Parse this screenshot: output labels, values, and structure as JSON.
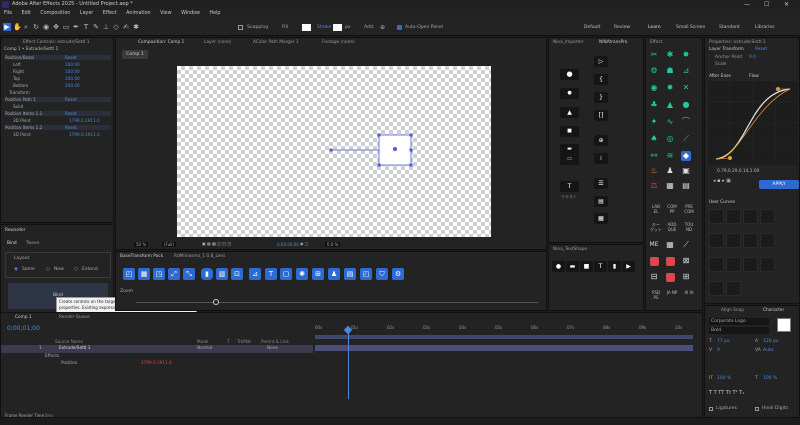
{
  "app": {
    "title": "Adobe After Effects 2025 - Untitled Project.aep *",
    "window_controls": [
      "—",
      "☐",
      "✕"
    ]
  },
  "menu": [
    "File",
    "Edit",
    "Composition",
    "Layer",
    "Effect",
    "Animation",
    "View",
    "Window",
    "Help"
  ],
  "toolbar": {
    "snapping_label": "Snapping",
    "fill_label": "Fill",
    "stroke_label": "Stroke",
    "stroke_value": "px",
    "add_label": "Add:",
    "auto_open_label": "Auto-Open Panel",
    "workspaces": [
      "Default",
      "Review",
      "Learn",
      "Small Screen",
      "Standard",
      "Libraries"
    ],
    "active_workspace": "Learn"
  },
  "effect_controls": {
    "tab": "Effect Controls: extrude/Settl 1",
    "title": "Comp 1 • Extrude/Settl 1",
    "rows": [
      {
        "label": "Position/Bezel",
        "value": "Reset",
        "indent": 0
      },
      {
        "label": "Left",
        "value": "100.00",
        "indent": 1
      },
      {
        "label": "Right",
        "value": "100.00",
        "indent": 1
      },
      {
        "label": "Top",
        "value": "100.00",
        "indent": 1
      },
      {
        "label": "Bottom",
        "value": "100.00",
        "indent": 1
      },
      {
        "label": "Transform",
        "value": "",
        "indent": 0
      },
      {
        "label": "Position Path 1",
        "value": "Reset",
        "indent": 0
      },
      {
        "label": "Solid",
        "value": "",
        "indent": 1
      },
      {
        "label": "Position Items 1.1",
        "value": "Reset",
        "indent": 0
      },
      {
        "label": "3D Point",
        "value": "1799.0,1911.0",
        "indent": 1
      },
      {
        "label": "Position Items 1.2",
        "value": "Reset",
        "indent": 0
      },
      {
        "label": "3D Point",
        "value": "1799.0,1911.0",
        "indent": 1
      }
    ]
  },
  "rewarder": {
    "tab": "Rewarder",
    "tabs": [
      "Bind",
      "Tween"
    ],
    "group": "Layout",
    "radios": [
      "Same",
      "New",
      "Extend"
    ],
    "button": "Bind",
    "tooltip": "Create controls on the target layer and bind them to the selected properties. Existing expressions will be replaced."
  },
  "composition": {
    "panel_tab": "Composition: Comp 1",
    "tabs": [
      "Layer (none)",
      "AColor Path Merger 1",
      "Footage (none)"
    ],
    "comp_label": "Comp 1",
    "zoom": "50 %",
    "resolution": "(Full)",
    "timecode": "0;00;00;00",
    "camera": "0.0 %"
  },
  "quick_panel": {
    "tabs": [
      "BaseTransform Pack",
      "RdMiniasmo_1.0.8_Lens"
    ],
    "zoom_label": "Zoom"
  },
  "nina_importer": {
    "tab": "Nina_Importer",
    "second_tab": "NINAtransPro",
    "thumb_label": "テキスト"
  },
  "nina_textshape": {
    "tab": "Nina_TextShape"
  },
  "effects_tab": "Effect",
  "text_buttons": [
    "LAB EL",
    "COM PP",
    "PRE COM",
    "キー ゲット",
    "ADD QUE",
    "TOU ND",
    "PSD PS",
    "JA NP",
    "AI AI"
  ],
  "flow_panel": {
    "tabs": [
      "Properties: extrude/Settl 1",
      "Effect Color"
    ],
    "subtabs": [
      "After Ease",
      "Flow"
    ],
    "sub_label": "Layer Transform",
    "sub_value": "Reset",
    "rows": [
      {
        "label": "Anchor Point",
        "value": "0.0"
      },
      {
        "label": "Scale",
        "value": ""
      }
    ],
    "values": "0.79,0.29,0.14,1.00",
    "apply_label": "APPLY",
    "curves_label": "User Curves"
  },
  "character": {
    "tabs": [
      "Align Snap",
      "Character"
    ],
    "font": "Corporate Logo",
    "style": "Bold",
    "size": "77 px",
    "leading": "120 px",
    "tracking": "Auto",
    "kerning": "0",
    "scale_v": "100 %",
    "scale_h": "100 %",
    "ligatures": "Ligatures",
    "hindi": "Hindi Digits"
  },
  "timeline": {
    "tab": "Comp 1",
    "render_tab": "Render Queue",
    "timecode": "0;00;01;00",
    "columns": [
      "Source Name",
      "Mode",
      "T",
      "TrkMat",
      "Parent & Link"
    ],
    "layers": [
      {
        "num": "1",
        "name": "Extrude/Settl 1",
        "mode": "Normal",
        "parent": "None"
      },
      {
        "name": "Effects"
      },
      {
        "name": "Position",
        "value": "1799.0,1911.0"
      }
    ],
    "ruler": [
      "00s",
      "01s",
      "02s",
      "03s",
      "04s",
      "05s",
      "06s",
      "07s",
      "08s",
      "09s",
      "10s"
    ],
    "footer": "Frame Render Time",
    "footer_val": "0ms"
  },
  "colors": {
    "accent": "#2d6bd3",
    "teal": "#1fc9a6",
    "red": "#e0454d",
    "orange": "#e09b3d",
    "blue_text": "#4a8ae0"
  }
}
